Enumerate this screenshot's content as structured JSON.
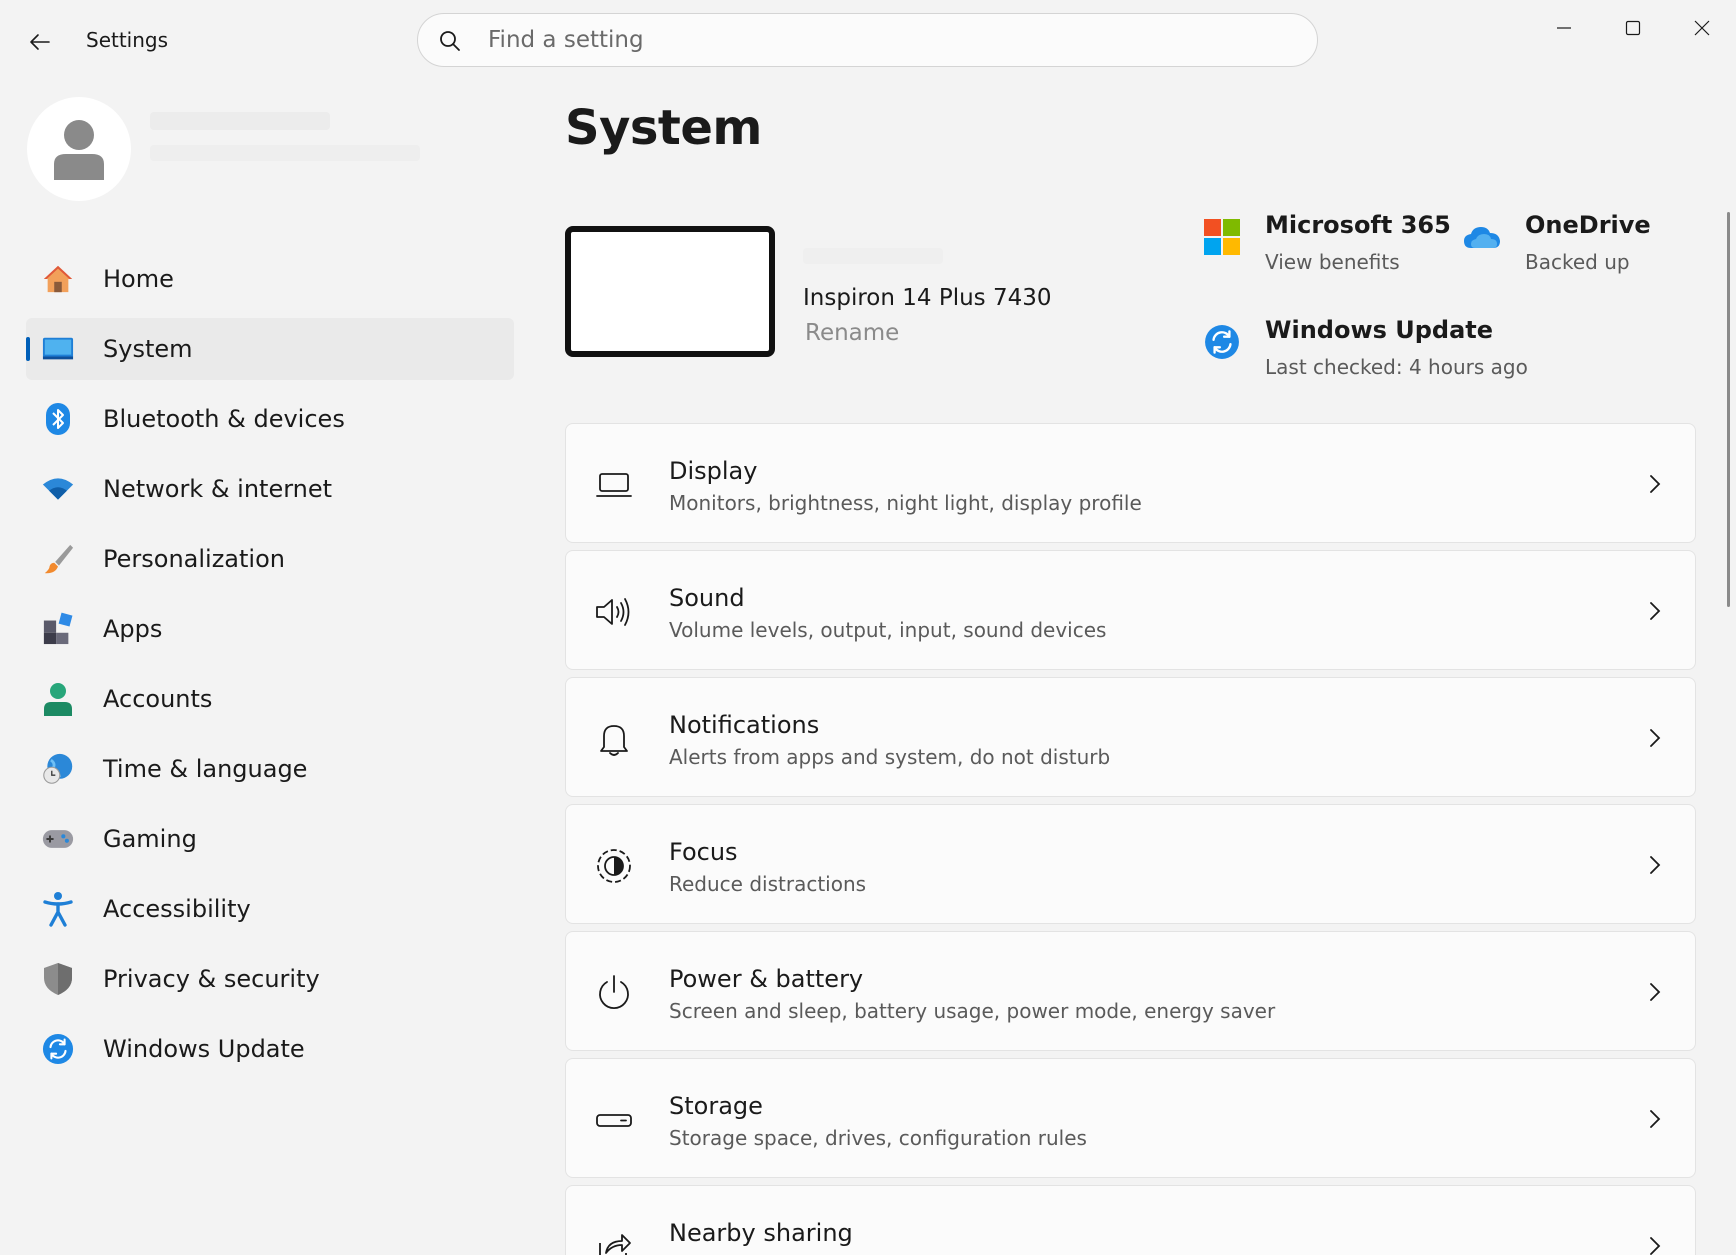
{
  "window": {
    "title": "Settings"
  },
  "search": {
    "placeholder": "Find a setting",
    "value": ""
  },
  "sidebar": {
    "items": [
      {
        "label": "Home",
        "icon": "home-icon",
        "selected": false
      },
      {
        "label": "System",
        "icon": "system-icon",
        "selected": true
      },
      {
        "label": "Bluetooth & devices",
        "icon": "bluetooth-icon",
        "selected": false
      },
      {
        "label": "Network & internet",
        "icon": "wifi-icon",
        "selected": false
      },
      {
        "label": "Personalization",
        "icon": "brush-icon",
        "selected": false
      },
      {
        "label": "Apps",
        "icon": "apps-icon",
        "selected": false
      },
      {
        "label": "Accounts",
        "icon": "accounts-icon",
        "selected": false
      },
      {
        "label": "Time & language",
        "icon": "globe-clock-icon",
        "selected": false
      },
      {
        "label": "Gaming",
        "icon": "gamepad-icon",
        "selected": false
      },
      {
        "label": "Accessibility",
        "icon": "accessibility-icon",
        "selected": false
      },
      {
        "label": "Privacy & security",
        "icon": "shield-icon",
        "selected": false
      },
      {
        "label": "Windows Update",
        "icon": "windows-update-icon",
        "selected": false
      }
    ]
  },
  "main": {
    "title": "System",
    "device": {
      "name": "Inspiron 14 Plus 7430",
      "rename_label": "Rename"
    },
    "tiles": {
      "m365": {
        "title": "Microsoft 365",
        "subtitle": "View benefits"
      },
      "onedrive": {
        "title": "OneDrive",
        "subtitle": "Backed up"
      },
      "windows_update": {
        "title": "Windows Update",
        "subtitle": "Last checked: 4 hours ago"
      }
    },
    "cards": [
      {
        "title": "Display",
        "subtitle": "Monitors, brightness, night light, display profile",
        "icon": "laptop-icon"
      },
      {
        "title": "Sound",
        "subtitle": "Volume levels, output, input, sound devices",
        "icon": "speaker-icon"
      },
      {
        "title": "Notifications",
        "subtitle": "Alerts from apps and system, do not disturb",
        "icon": "bell-icon"
      },
      {
        "title": "Focus",
        "subtitle": "Reduce distractions",
        "icon": "focus-icon"
      },
      {
        "title": "Power & battery",
        "subtitle": "Screen and sleep, battery usage, power mode, energy saver",
        "icon": "power-icon"
      },
      {
        "title": "Storage",
        "subtitle": "Storage space, drives, configuration rules",
        "icon": "storage-icon"
      },
      {
        "title": "Nearby sharing",
        "subtitle": "",
        "icon": "share-icon"
      }
    ]
  },
  "colors": {
    "accent": "#005fb8",
    "background": "#f3f3f3",
    "card": "#fbfbfb"
  }
}
